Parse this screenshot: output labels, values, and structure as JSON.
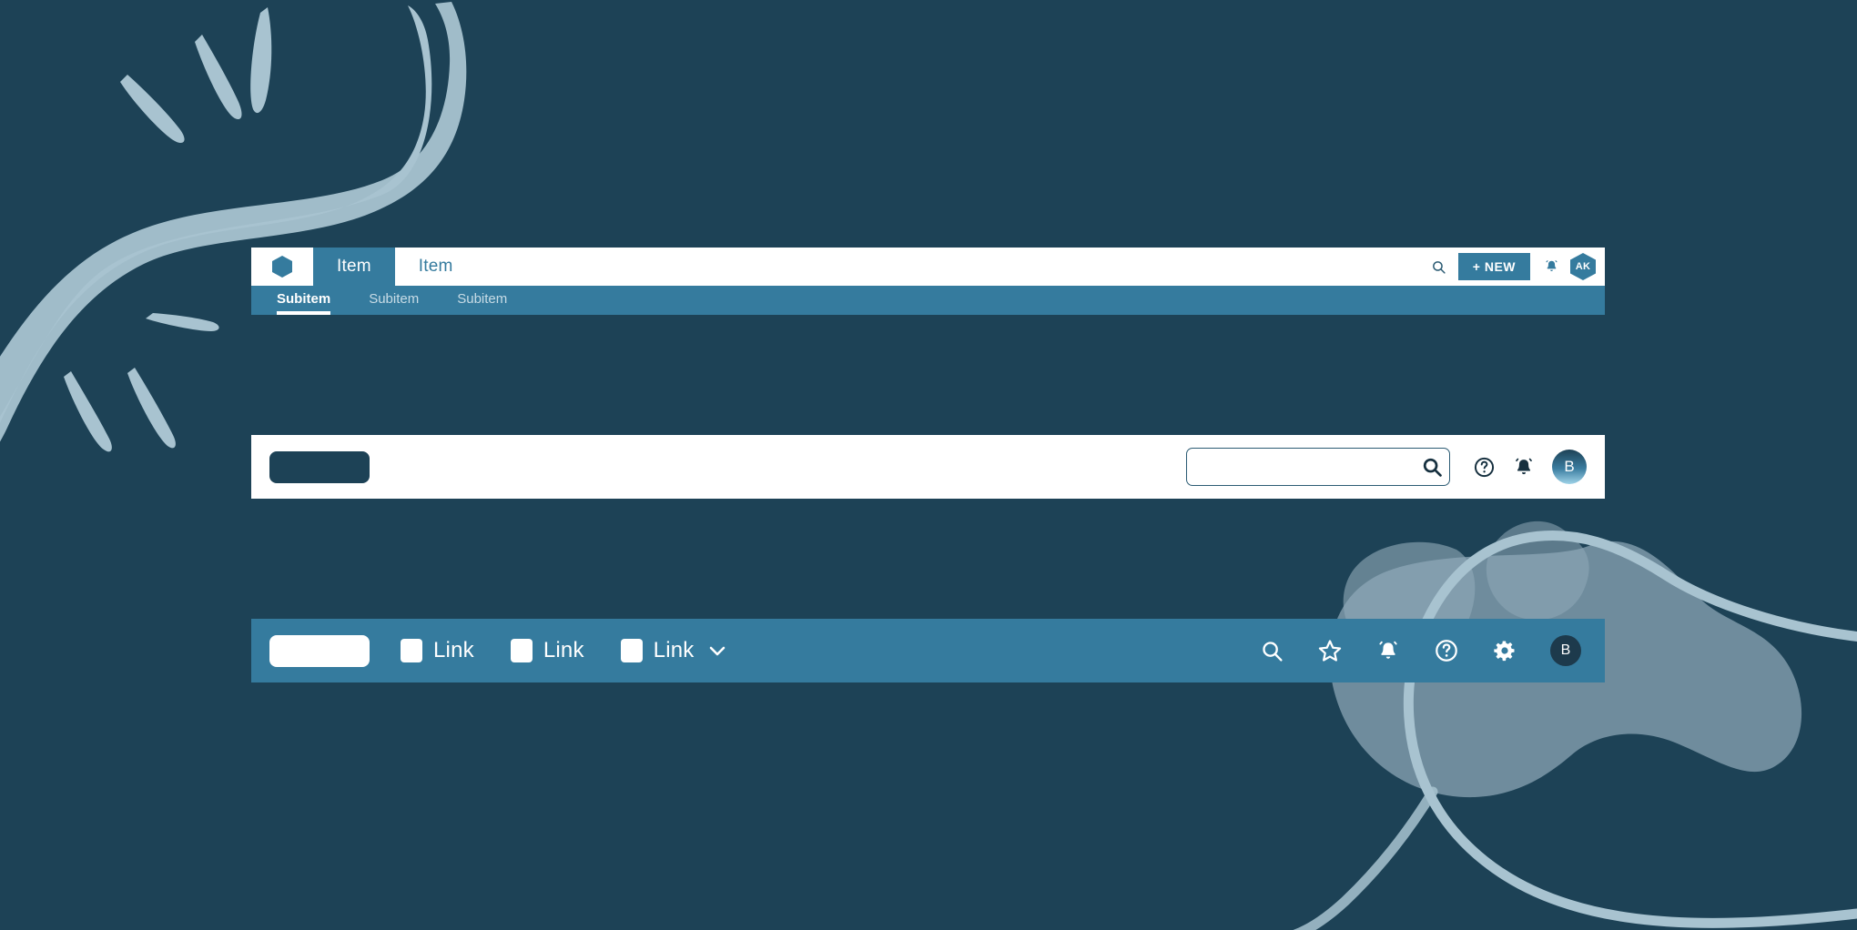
{
  "theme": {
    "background": "#1d4256",
    "accent_teal": "#357b9e",
    "dark_navy": "#1d4256",
    "white": "#ffffff",
    "decor_light": "#a8c3d0"
  },
  "top_nav": {
    "logo_icon": "hexagon-icon",
    "tabs": [
      {
        "label": "Item",
        "active": true
      },
      {
        "label": "Item",
        "active": false
      }
    ],
    "search_icon": "search-icon",
    "new_button_label": "+ NEW",
    "notifications_icon": "bell-icon",
    "avatar_initials": "AK",
    "subitems": [
      {
        "label": "Subitem",
        "active": true
      },
      {
        "label": "Subitem",
        "active": false
      },
      {
        "label": "Subitem",
        "active": false
      }
    ]
  },
  "mid_bar": {
    "logo_placeholder": "logo-block",
    "search": {
      "value": "",
      "placeholder": "",
      "icon": "search-icon"
    },
    "icons": [
      {
        "name": "help-icon"
      },
      {
        "name": "bell-icon"
      }
    ],
    "avatar_initials": "B"
  },
  "bottom_bar": {
    "logo_placeholder": "logo-block",
    "links": [
      {
        "label": "Link",
        "has_chevron": false
      },
      {
        "label": "Link",
        "has_chevron": false
      },
      {
        "label": "Link",
        "has_chevron": true
      }
    ],
    "chevron_icon": "chevron-down-icon",
    "icons": [
      {
        "name": "search-icon"
      },
      {
        "name": "star-icon"
      },
      {
        "name": "bell-icon"
      },
      {
        "name": "help-icon"
      },
      {
        "name": "gear-icon"
      }
    ],
    "avatar_initials": "B"
  }
}
